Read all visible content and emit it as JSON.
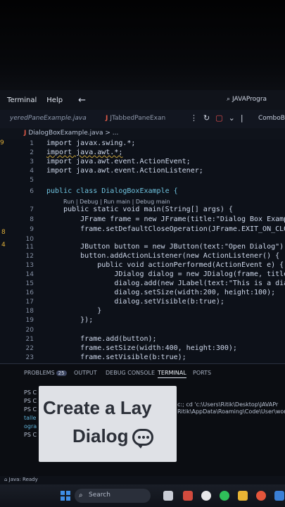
{
  "menubar": {
    "items": [
      "Terminal",
      "Help"
    ],
    "search": "JAVAProgra"
  },
  "tabs": {
    "tab1": "yeredPaneExample.java",
    "tab2": "JTabbedPaneExan",
    "tab3": "ComboBo"
  },
  "breadcrumb": "DialogBoxExample.java > ...",
  "editor": {
    "lines": [
      {
        "n": "1",
        "code": "import javax.swing.*;"
      },
      {
        "n": "2",
        "code": "import java.awt.*;"
      },
      {
        "n": "3",
        "code": "import java.awt.event.ActionEvent;"
      },
      {
        "n": "4",
        "code": "import java.awt.event.ActionListener;"
      },
      {
        "n": "5",
        "code": ""
      },
      {
        "n": "6",
        "code": "public class DialogBoxExample {"
      },
      {
        "n": "7",
        "code": "    public static void main(String[] args) {"
      },
      {
        "n": "8",
        "code": "        JFrame frame = new JFrame(title:\"Dialog Box Example\");"
      },
      {
        "n": "9",
        "code": "        frame.setDefaultCloseOperation(JFrame.EXIT_ON_CLOSE);"
      },
      {
        "n": "10",
        "code": ""
      },
      {
        "n": "11",
        "code": "        JButton button = new JButton(text:\"Open Dialog\");"
      },
      {
        "n": "12",
        "code": "        button.addActionListener(new ActionListener() {"
      },
      {
        "n": "13",
        "code": "            public void actionPerformed(ActionEvent e) {"
      },
      {
        "n": "14",
        "code": "                JDialog dialog = new JDialog(frame, title:\"Dialog"
      },
      {
        "n": "15",
        "code": "                dialog.add(new JLabel(text:\"This is a dialog box."
      },
      {
        "n": "16",
        "code": "                dialog.setSize(width:200, height:100);"
      },
      {
        "n": "17",
        "code": "                dialog.setVisible(b:true);"
      },
      {
        "n": "18",
        "code": "            }"
      },
      {
        "n": "19",
        "code": "        });"
      },
      {
        "n": "20",
        "code": ""
      },
      {
        "n": "21",
        "code": "        frame.add(button);"
      },
      {
        "n": "22",
        "code": "        frame.setSize(width:400, height:300);"
      },
      {
        "n": "23",
        "code": "        frame.setVisible(b:true);"
      }
    ],
    "codelens": "Run | Debug | Run main | Debug main",
    "gutter_marks": [
      "9",
      "8",
      "4"
    ]
  },
  "panel": {
    "tabs": [
      "PROBLEMS",
      "OUTPUT",
      "DEBUG CONSOLE",
      "TERMINAL",
      "PORTS"
    ],
    "problems_count": "25",
    "terminal_lines": [
      "PS C",
      "PS C",
      "PS C",
      "talle",
      "ogra",
      "PS C"
    ],
    "cmd_right": "c:; cd 'c:\\Users\\Ritik\\Desktop\\JAVAPr",
    "cmd_right2": "Ritik\\AppData\\Roaming\\Code\\User\\work"
  },
  "overlay": {
    "line1": "Create a Lay",
    "line2": "Dialog"
  },
  "statusbar": "Java: Ready",
  "taskbar": {
    "search": "Search"
  }
}
